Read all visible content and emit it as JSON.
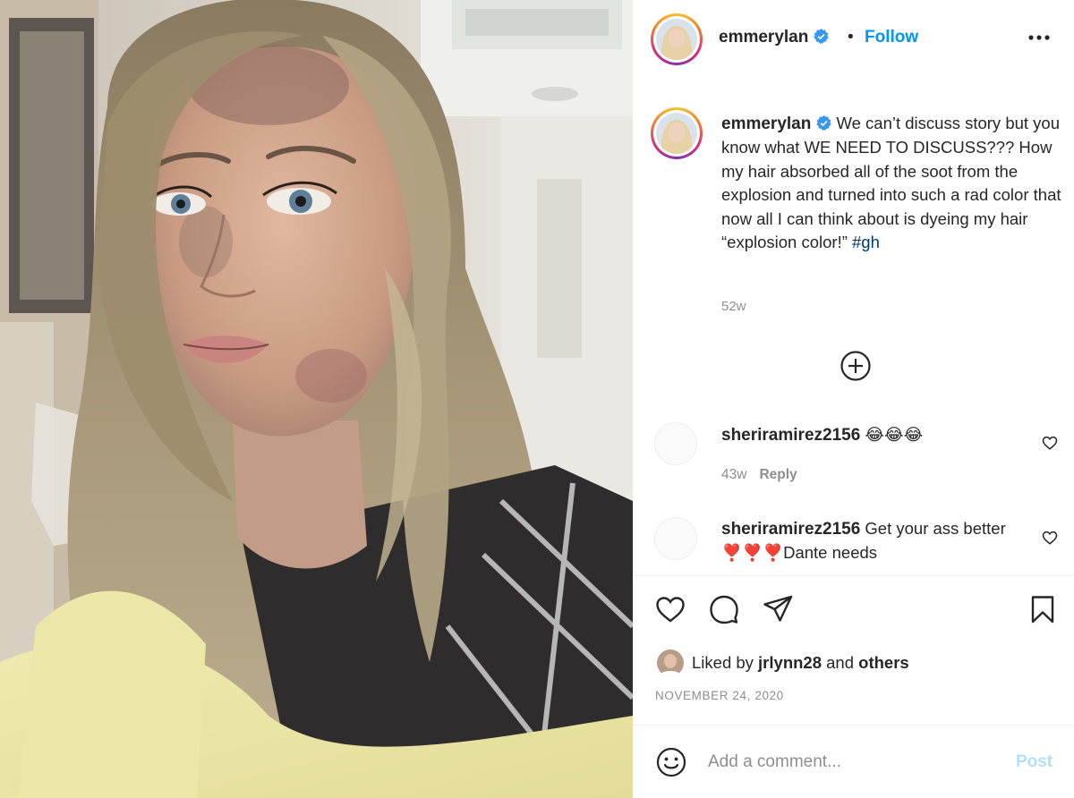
{
  "post": {
    "username": "emmerylan",
    "verified": true,
    "follow_label": "Follow",
    "separator": "•",
    "image_alt": "Selfie of a woman with long light-brown hair and soot on her face, wearing a yellow hospital gown"
  },
  "caption": {
    "username": "emmerylan",
    "text": "We can’t discuss story but you know what WE NEED TO DISCUSS??? How my hair absorbed all of the soot from the explosion and turned into such a rad color that now all I can think about is dyeing my hair “explosion color!”",
    "hashtag": "#gh",
    "time": "52w"
  },
  "comments": [
    {
      "username": "sheriramirez2156",
      "text": "😂😂😂",
      "time": "43w",
      "reply_label": "Reply"
    },
    {
      "username": "sheriramirez2156",
      "text": "Get your ass better ❣️❣️❣️Dante needs"
    }
  ],
  "actions": {
    "like_icon": "heart-icon",
    "comment_icon": "comment-icon",
    "share_icon": "paper-plane-icon",
    "save_icon": "bookmark-icon"
  },
  "likes": {
    "prefix": "Liked by",
    "user": "jrlynn28",
    "conjunction": "and",
    "others": "others"
  },
  "date": "NOVEMBER 24, 2020",
  "comment_box": {
    "placeholder": "Add a comment...",
    "post_label": "Post"
  },
  "colors": {
    "accent": "#0095f6",
    "text": "#262626",
    "muted": "#8e8e8e",
    "hashtag": "#00376b",
    "post_disabled": "#b2dffc"
  }
}
